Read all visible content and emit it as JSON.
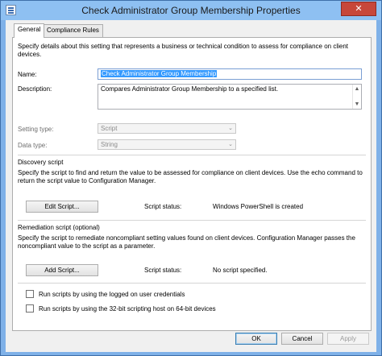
{
  "window": {
    "title": "Check Administrator Group Membership Properties",
    "close_glyph": "✕"
  },
  "tabs": [
    {
      "label": "General",
      "active": true
    },
    {
      "label": "Compliance Rules",
      "active": false
    }
  ],
  "general": {
    "intro": "Specify details about this setting that represents a business or technical condition to assess for compliance on client devices.",
    "name_label": "Name:",
    "name_value": "Check Administrator Group Membership",
    "description_label": "Description:",
    "description_value": "Compares Administrator Group Membership to a specified list.",
    "setting_type_label": "Setting type:",
    "setting_type_value": "Script",
    "data_type_label": "Data type:",
    "data_type_value": "String"
  },
  "discovery": {
    "heading": "Discovery script",
    "description": "Specify the script to find and return the value to be assessed for compliance on client devices. Use the echo command to return the script value to Configuration Manager.",
    "button_label": "Edit Script...",
    "status_label": "Script status:",
    "status_value": "Windows PowerShell is created"
  },
  "remediation": {
    "heading": "Remediation script (optional)",
    "description": "Specify the script to remediate noncompliant setting values found on client devices. Configuration Manager passes the noncompliant value to the script as a parameter.",
    "button_label": "Add Script...",
    "status_label": "Script status:",
    "status_value": "No script specified."
  },
  "options": {
    "logged_on_credentials": "Run scripts by using the logged on user credentials",
    "scripting_host_32bit": "Run scripts by using the 32-bit scripting host on 64-bit devices"
  },
  "footer": {
    "ok": "OK",
    "cancel": "Cancel",
    "apply": "Apply"
  }
}
